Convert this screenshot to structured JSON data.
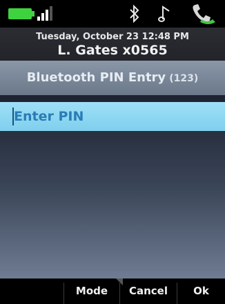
{
  "status_bar": {
    "battery_color": "#3fd23f",
    "icons": [
      "battery-icon",
      "signal-icon",
      "bluetooth-icon",
      "music-note-icon",
      "handset-icon"
    ]
  },
  "header": {
    "date_time": "Tuesday, October 23 12:48 PM",
    "user_line": "L. Gates x0565"
  },
  "title_bar": {
    "title": "Bluetooth PIN Entry",
    "input_mode": "(123)"
  },
  "pin_field": {
    "value": "",
    "placeholder": "Enter PIN"
  },
  "softkeys": {
    "blank": "",
    "mode": "Mode",
    "cancel": "Cancel",
    "ok": "Ok"
  },
  "colors": {
    "title_bar": "#7d8a9c",
    "pin_field": "#8fd8f2",
    "pin_text": "#2a7cb6"
  }
}
